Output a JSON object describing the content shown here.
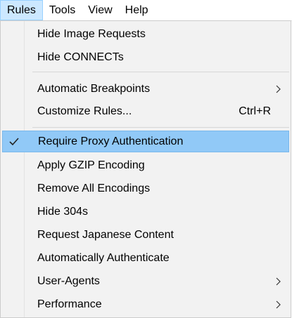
{
  "menubar": {
    "items": [
      "Rules",
      "Tools",
      "View",
      "Help"
    ]
  },
  "menu": {
    "items": [
      {
        "label": "Hide Image Requests"
      },
      {
        "label": "Hide CONNECTs"
      },
      {
        "label": "Automatic Breakpoints"
      },
      {
        "label": "Customize Rules...",
        "shortcut": "Ctrl+R"
      },
      {
        "label": "Require Proxy Authentication",
        "checked": true,
        "highlighted": true
      },
      {
        "label": "Apply GZIP Encoding"
      },
      {
        "label": "Remove All Encodings"
      },
      {
        "label": "Hide 304s"
      },
      {
        "label": "Request Japanese Content"
      },
      {
        "label": "Automatically Authenticate"
      },
      {
        "label": "User-Agents",
        "submenu": true
      },
      {
        "label": "Performance",
        "submenu": true
      }
    ]
  },
  "colors": {
    "highlight": "#91c9f7",
    "menubar_active": "#cce8ff",
    "menu_background": "#f2f2f2"
  },
  "icons": {
    "check": "checkmark-icon",
    "submenu": "chevron-right-icon"
  }
}
